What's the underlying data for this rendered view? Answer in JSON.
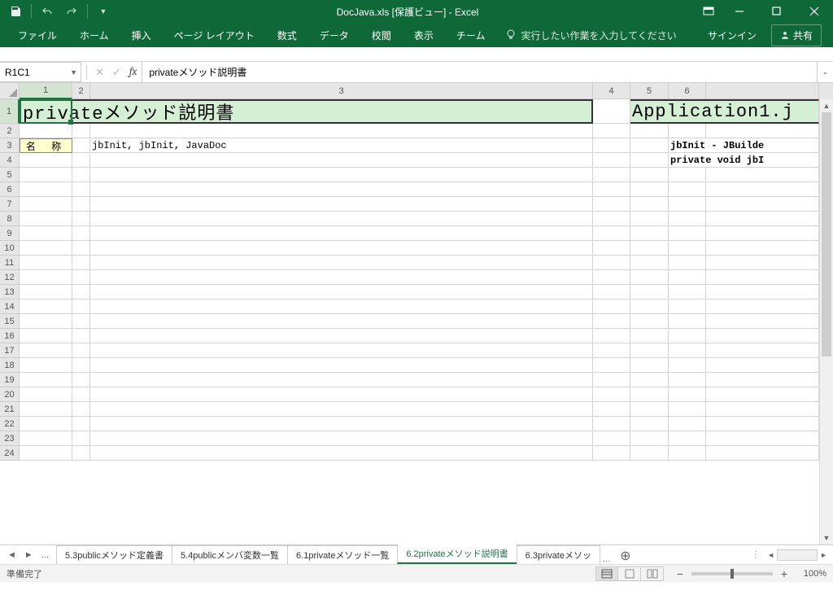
{
  "titlebar": {
    "title": "DocJava.xls  [保護ビュー] - Excel"
  },
  "ribbon": {
    "file": "ファイル",
    "home": "ホーム",
    "insert": "挿入",
    "pagelayout": "ページ レイアウト",
    "formulas": "数式",
    "data": "データ",
    "review": "校閲",
    "view": "表示",
    "team": "チーム",
    "tellme": "実行したい作業を入力してください",
    "signin": "サインイン",
    "share": "共有"
  },
  "fbar": {
    "namebox": "R1C1",
    "formula": "privateメソッド説明書"
  },
  "cols": {
    "c1": "1",
    "c2": "2",
    "c3": "3",
    "c4": "4",
    "c5": "5",
    "c6": "6"
  },
  "cells": {
    "r1_title": "privateメソッド説明書",
    "r1_title2": "Application1.j",
    "r3_label": "名 称",
    "r3_val": "jbInit, jbInit, JavaDoc",
    "r3_right": "jbInit - JBuilde",
    "r4_right": "private void jbI"
  },
  "sheettabs": {
    "t1": "5.3publicメソッド定義書",
    "t2": "5.4publicメンバ変数一覧",
    "t3": "6.1privateメソッド一覧",
    "t4": "6.2privateメソッド説明書",
    "t5": "6.3privateメソッ",
    "dots": "..."
  },
  "status": {
    "ready": "準備完了",
    "zoom": "100%"
  }
}
